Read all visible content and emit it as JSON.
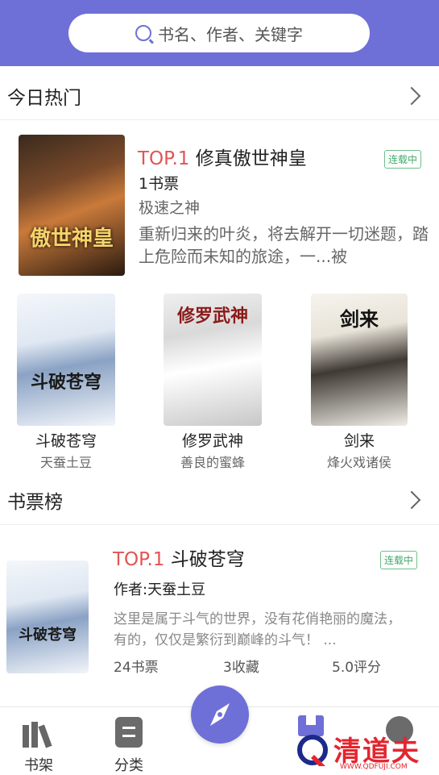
{
  "search": {
    "placeholder_text": "书名、作者、关键字"
  },
  "hot_today": {
    "title": "今日热门",
    "featured": {
      "rank": "TOP.1",
      "name": "修真傲世神皇",
      "status": "连载中",
      "votes": "1书票",
      "author": "极速之神",
      "desc": "重新归来的叶炎，将去解开一切迷题，踏上危险而未知的旅途，一...被",
      "cover_text": "傲世神皇"
    },
    "grid": [
      {
        "name": "斗破苍穹",
        "author": "天蚕土豆",
        "cover_text": "斗破苍穹"
      },
      {
        "name": "修罗武神",
        "author": "善良的蜜蜂",
        "cover_text": "修罗武神"
      },
      {
        "name": "剑来",
        "author": "烽火戏诸侯",
        "cover_text": "剑来"
      }
    ]
  },
  "vote_rank": {
    "title": "书票榜",
    "featured": {
      "rank": "TOP.1",
      "name": "斗破苍穹",
      "status": "连载中",
      "author_line": "作者:天蚕土豆",
      "desc": "这里是属于斗气的世界，没有花俏艳丽的魔法，有的，仅仅是繁衍到巅峰的斗气！ ...",
      "votes": "24书票",
      "favorites": "3收藏",
      "score": "5.0评分",
      "cover_text": "斗破苍穹"
    }
  },
  "bottom_nav": [
    {
      "label": "书架",
      "icon": "bookshelf-icon"
    },
    {
      "label": "分类",
      "icon": "category-icon"
    },
    {
      "label": "",
      "icon": "compass-icon"
    },
    {
      "label": "",
      "icon": "bookmark-icon"
    },
    {
      "label": "",
      "icon": "profile-icon"
    }
  ],
  "watermark": {
    "text": "清道夫",
    "url": "WWW.QDFUJI.COM"
  },
  "colors": {
    "accent": "#6f6fd8",
    "rank_red": "#e05555",
    "status_green": "#43a86a"
  }
}
